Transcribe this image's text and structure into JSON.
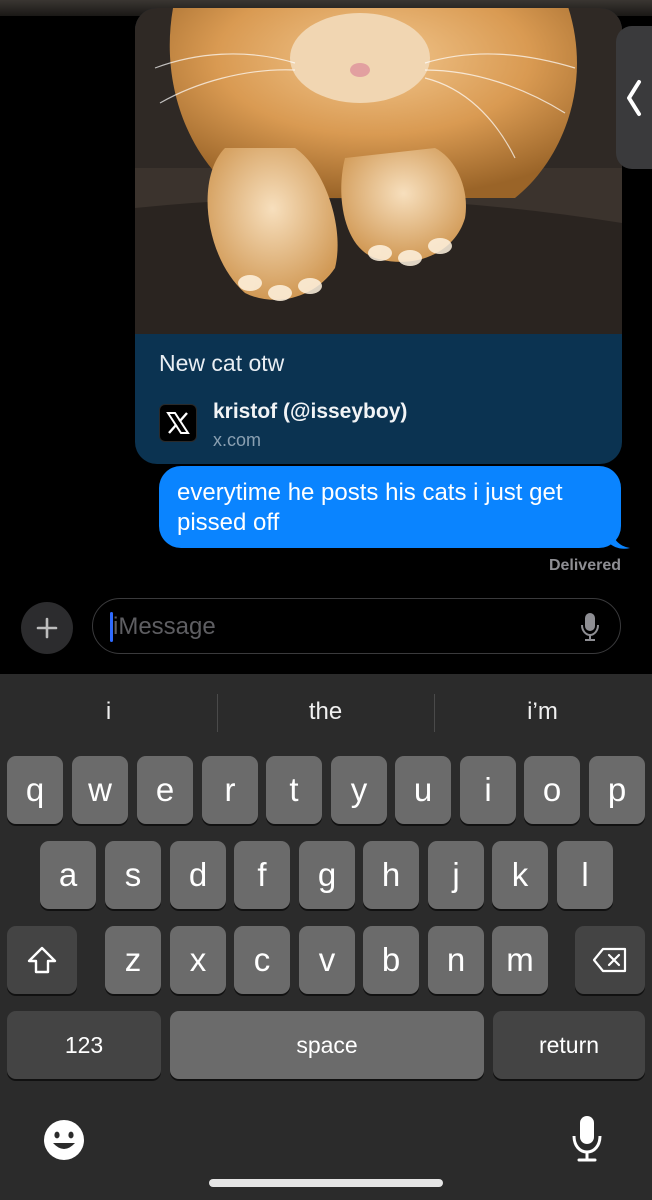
{
  "link_preview": {
    "caption": "New cat otw",
    "source_name": "kristof (@isseyboy)",
    "source_domain": "x.com"
  },
  "message": {
    "text": "everytime he posts his cats i just get pissed off",
    "status": "Delivered"
  },
  "compose": {
    "placeholder": "iMessage"
  },
  "keyboard": {
    "suggestions": [
      "i",
      "the",
      "i’m"
    ],
    "row1": [
      "q",
      "w",
      "e",
      "r",
      "t",
      "y",
      "u",
      "i",
      "o",
      "p"
    ],
    "row2": [
      "a",
      "s",
      "d",
      "f",
      "g",
      "h",
      "j",
      "k",
      "l"
    ],
    "row3": [
      "z",
      "x",
      "c",
      "v",
      "b",
      "n",
      "m"
    ],
    "numbers_label": "123",
    "space_label": "space",
    "return_label": "return"
  },
  "colors": {
    "bubble_blue": "#0a84ff",
    "card_background": "#0b3351",
    "key_background": "#6b6b6b",
    "keyboard_background": "#2b2b2b"
  },
  "icons": [
    "plus-icon",
    "microphone-icon",
    "x-logo-icon",
    "shift-icon",
    "backspace-icon",
    "emoji-icon",
    "dictation-icon",
    "chevron-left-icon"
  ]
}
